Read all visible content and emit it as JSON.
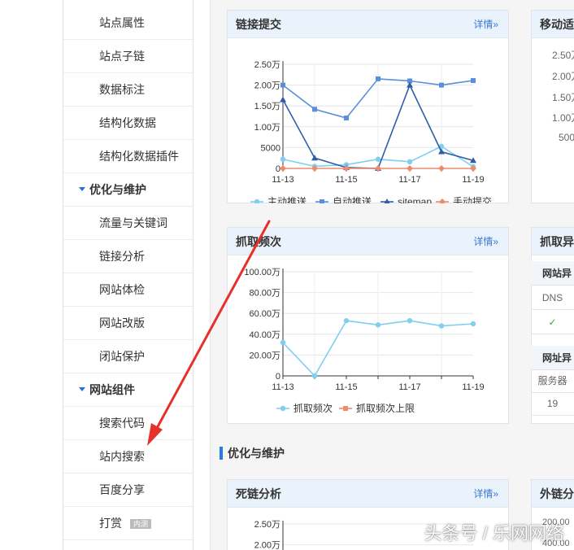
{
  "sidebar": {
    "rows": [
      {
        "type": "item",
        "label": "站点属性"
      },
      {
        "type": "item",
        "label": "站点子链"
      },
      {
        "type": "item",
        "label": "数据标注"
      },
      {
        "type": "item",
        "label": "结构化数据"
      },
      {
        "type": "item",
        "label": "结构化数据插件"
      },
      {
        "type": "section",
        "label": "优化与维护"
      },
      {
        "type": "item",
        "label": "流量与关键词"
      },
      {
        "type": "item",
        "label": "链接分析"
      },
      {
        "type": "item",
        "label": "网站体检"
      },
      {
        "type": "item",
        "label": "网站改版"
      },
      {
        "type": "item",
        "label": "闭站保护"
      },
      {
        "type": "section",
        "label": "网站组件"
      },
      {
        "type": "item",
        "label": "搜索代码"
      },
      {
        "type": "item",
        "label": "站内搜索"
      },
      {
        "type": "item",
        "label": "百度分享"
      },
      {
        "type": "item",
        "label": "打赏",
        "badge": "内测"
      }
    ]
  },
  "main": {
    "section_title": "优化与维护",
    "more_label": "详情»",
    "cards": {
      "link_submit": {
        "title": "链接提交"
      },
      "crawl_freq": {
        "title": "抓取频次"
      },
      "dead_link": {
        "title": "死链分析"
      },
      "mobile_peek": {
        "title": "移动适"
      },
      "crawl_error_peek": {
        "title": "抓取异"
      },
      "external_peek": {
        "title": "外链分"
      }
    },
    "peek": {
      "mobile_ticks": [
        "2.50万",
        "2.00万",
        "1.50万",
        "1.00万",
        "500"
      ],
      "table_cells": [
        "网站异",
        "DNS",
        "✓",
        "网址异",
        "服务器",
        "19"
      ],
      "external_ticks": [
        "200.00",
        "400.00"
      ]
    }
  },
  "watermark": "头条号 / 乐网网络",
  "colors": {
    "accent": "#2a7ae2",
    "series_active": "#7fcfef",
    "series_auto": "#5a8fdc",
    "series_sitemap": "#2f5ea8",
    "series_manual": "#f08a6c",
    "arrow": "#e8302a"
  },
  "chart_data": [
    {
      "type": "line",
      "title": "链接提交",
      "x": [
        "11-13",
        "11-14",
        "11-15",
        "11-16",
        "11-17",
        "11-18",
        "11-19"
      ],
      "x_tick_labels": [
        "11-13",
        "11-15",
        "11-17",
        "11-19"
      ],
      "y_tick_labels": [
        "2.50万",
        "2.00万",
        "1.50万",
        "1.00万",
        "5000",
        "0"
      ],
      "ylim": [
        0,
        25000
      ],
      "grid": true,
      "legend_position": "bottom",
      "series": [
        {
          "name": "主动推送",
          "marker": "circle",
          "values": [
            2200,
            500,
            900,
            2200,
            1600,
            5300,
            400
          ]
        },
        {
          "name": "自动推送",
          "marker": "square",
          "values": [
            20000,
            14200,
            12100,
            21500,
            21000,
            20000,
            21100
          ]
        },
        {
          "name": "sitemap",
          "marker": "triangle",
          "values": [
            16500,
            2500,
            200,
            0,
            20000,
            4000,
            1900
          ]
        },
        {
          "name": "手动提交",
          "marker": "diamond",
          "values": [
            0,
            0,
            0,
            0,
            0,
            0,
            0
          ]
        }
      ]
    },
    {
      "type": "line",
      "title": "抓取频次",
      "x": [
        "11-13",
        "11-14",
        "11-15",
        "11-16",
        "11-17",
        "11-18",
        "11-19"
      ],
      "x_tick_labels": [
        "11-13",
        "11-15",
        "11-17",
        "11-19"
      ],
      "y_tick_labels": [
        "100.00万",
        "80.00万",
        "60.00万",
        "40.00万",
        "20.00万",
        "0"
      ],
      "ylim": [
        0,
        1000000
      ],
      "grid": true,
      "legend_position": "bottom",
      "series": [
        {
          "name": "抓取频次",
          "marker": "circle",
          "values": [
            320000,
            0,
            530000,
            490000,
            530000,
            480000,
            500000
          ]
        },
        {
          "name": "抓取频次上限",
          "marker": "square",
          "values": []
        }
      ]
    },
    {
      "type": "line",
      "title": "死链分析",
      "y_tick_labels": [
        "2.50万",
        "2.00万"
      ],
      "grid": true,
      "series": []
    }
  ]
}
